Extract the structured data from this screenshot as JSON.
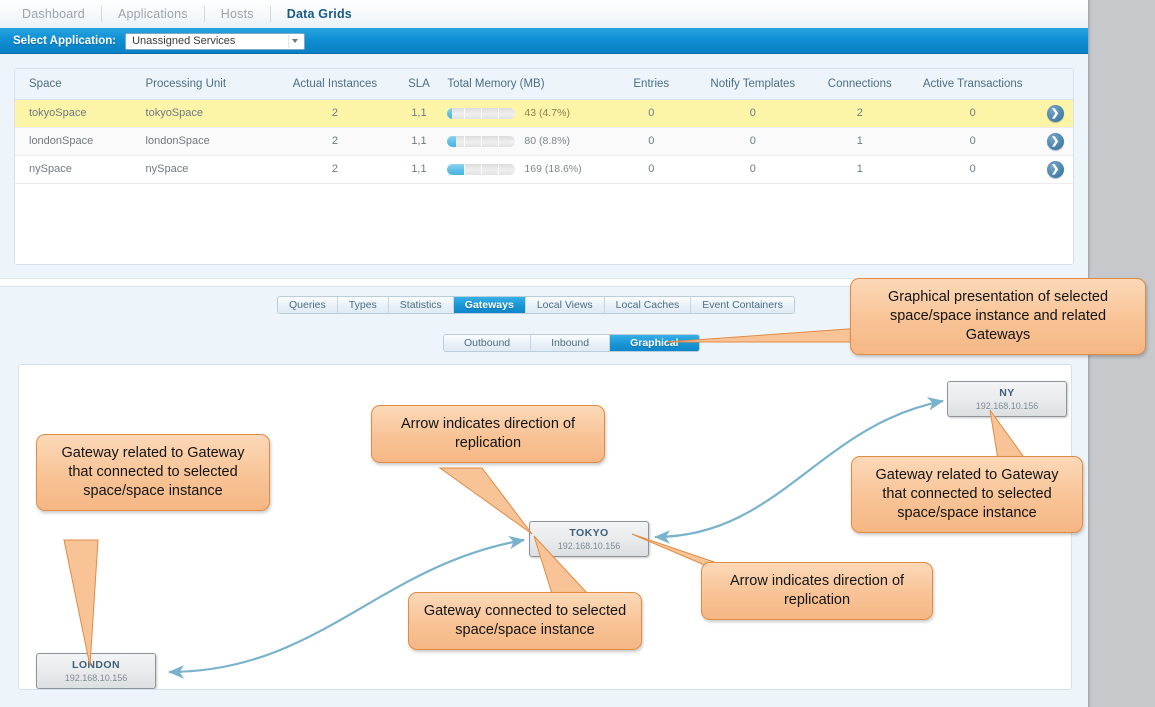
{
  "topnav": {
    "items": [
      {
        "label": "Dashboard",
        "active": false
      },
      {
        "label": "Applications",
        "active": false
      },
      {
        "label": "Hosts",
        "active": false
      },
      {
        "label": "Data Grids",
        "active": true
      }
    ]
  },
  "appbar": {
    "label": "Select Application:",
    "selected": "Unassigned Services",
    "caret_icon": "chevron-down-icon"
  },
  "grid": {
    "columns": [
      "Space",
      "Processing Unit",
      "Actual Instances",
      "SLA",
      "Total Memory (MB)",
      "Entries",
      "Notify Templates",
      "Connections",
      "Active Transactions"
    ],
    "rows": [
      {
        "space": "tokyoSpace",
        "processing_unit": "tokyoSpace",
        "actual_instances": "2",
        "sla": "1,1",
        "memory_text": "43 (4.7%)",
        "memory_pct": 4.7,
        "entries": "0",
        "notify_templates": "0",
        "connections": "2",
        "active_transactions": "0",
        "selected": true
      },
      {
        "space": "londonSpace",
        "processing_unit": "londonSpace",
        "actual_instances": "2",
        "sla": "1,1",
        "memory_text": "80 (8.8%)",
        "memory_pct": 8.8,
        "entries": "0",
        "notify_templates": "0",
        "connections": "1",
        "active_transactions": "0",
        "selected": false
      },
      {
        "space": "nySpace",
        "processing_unit": "nySpace",
        "actual_instances": "2",
        "sla": "1,1",
        "memory_text": "169 (18.6%)",
        "memory_pct": 18.6,
        "entries": "0",
        "notify_templates": "0",
        "connections": "1",
        "active_transactions": "0",
        "selected": false
      }
    ],
    "row_expand_icon": "chevron-right-icon"
  },
  "tabs_primary": [
    {
      "label": "Queries",
      "active": false
    },
    {
      "label": "Types",
      "active": false
    },
    {
      "label": "Statistics",
      "active": false
    },
    {
      "label": "Gateways",
      "active": true
    },
    {
      "label": "Local Views",
      "active": false
    },
    {
      "label": "Local Caches",
      "active": false
    },
    {
      "label": "Event Containers",
      "active": false
    }
  ],
  "tabs_secondary": [
    {
      "label": "Outbound",
      "active": false
    },
    {
      "label": "Inbound",
      "active": false
    },
    {
      "label": "Graphical",
      "active": true
    }
  ],
  "diagram": {
    "nodes": [
      {
        "id": "ny",
        "title": "NY",
        "ip": "192.168.10.156"
      },
      {
        "id": "tokyo",
        "title": "TOKYO",
        "ip": "192.168.10.156"
      },
      {
        "id": "london",
        "title": "LONDON",
        "ip": "192.168.10.156"
      }
    ],
    "edge_color": "#79b2cc"
  },
  "callouts": {
    "graphical": "Graphical presentation  of selected space/space instance and related Gateways",
    "left": "Gateway related to Gateway that connected to selected  space/space instance",
    "arrow_top": "Arrow indicates direction of replication",
    "right": "Gateway related to Gateway that connected to selected  space/space instance",
    "arrow_bottom": "Arrow indicates direction of replication",
    "bottom": "Gateway connected to selected  space/space instance"
  },
  "colors": {
    "accent_blue": "#0e8fd4",
    "callout_fill": "#f8c396",
    "callout_border": "#e08c45",
    "row_selected": "#fcf5a8",
    "edge": "#79b2cc"
  }
}
